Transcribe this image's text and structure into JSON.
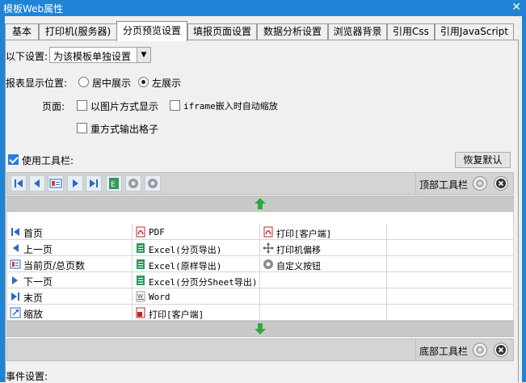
{
  "window": {
    "title": "模板Web属性"
  },
  "tabs": [
    {
      "label": "基本"
    },
    {
      "label": "打印机(服务器)"
    },
    {
      "label": "分页预览设置"
    },
    {
      "label": "填报页面设置"
    },
    {
      "label": "数据分析设置"
    },
    {
      "label": "浏览器背景"
    },
    {
      "label": "引用Css"
    },
    {
      "label": "引用JavaScript"
    }
  ],
  "settings": {
    "scope_label": "以下设置:",
    "scope_value": "为该模板单独设置",
    "position_label": "报表显示位置:",
    "position_options": [
      "居中展示",
      "左展示"
    ],
    "page_label": "页面:",
    "page_options": [
      "以图片方式显示",
      "iframe嵌入时自动缩放",
      "重方式输出格子"
    ],
    "use_toolbar_label": "使用工具栏:",
    "restore_default": "恢复默认"
  },
  "toolbars": {
    "top_label": "顶部工具栏",
    "bottom_label": "底部工具栏"
  },
  "buttons_grid": {
    "col1": [
      "首页",
      "上一页",
      "当前页/总页数",
      "下一页",
      "末页",
      "缩放"
    ],
    "col2": [
      "PDF",
      "Excel(分页导出)",
      "Excel(原样导出)",
      "Excel(分页分Sheet导出)",
      "Word",
      "打印[客户端]"
    ],
    "col3": [
      "打印[客户端]",
      "打印机偏移",
      "自定义按钮"
    ]
  },
  "events": {
    "label": "事件设置:"
  }
}
